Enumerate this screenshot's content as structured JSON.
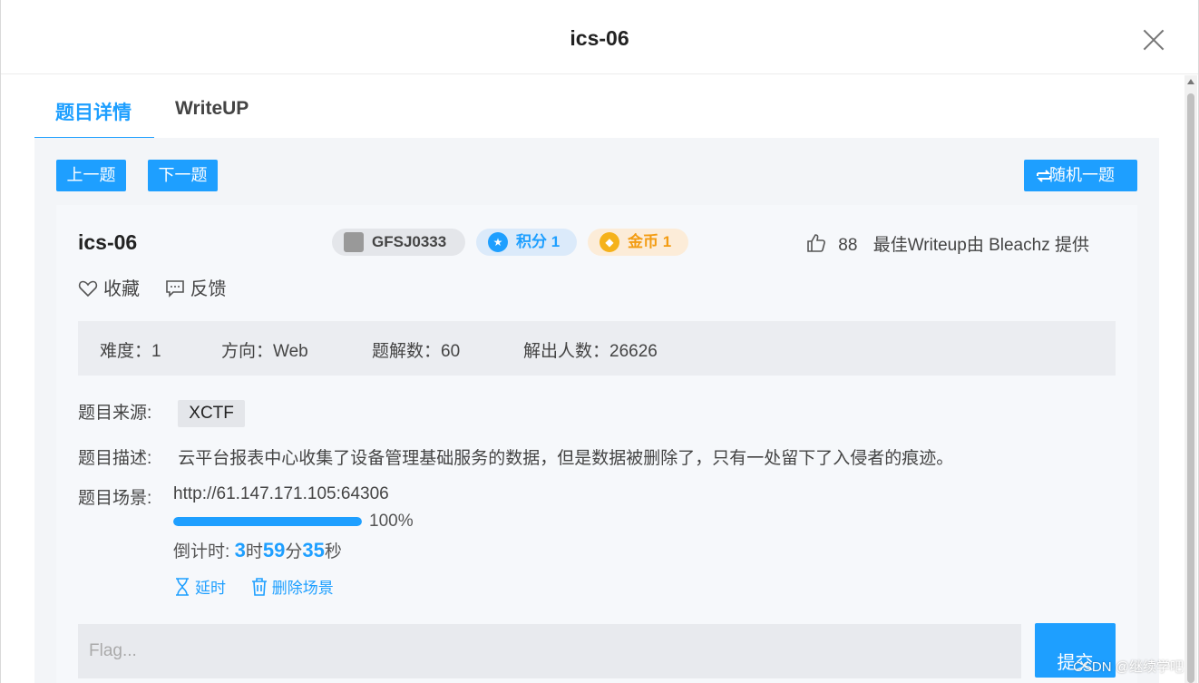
{
  "modal": {
    "title": "ics-06"
  },
  "tabs": [
    {
      "label": "题目详情"
    },
    {
      "label": "WriteUP"
    }
  ],
  "nav": {
    "prev": "上一题",
    "next": "下一题",
    "random": "随机一题"
  },
  "question": {
    "title": "ics-06",
    "badges": {
      "id": "GFSJ0333",
      "score": "积分 1",
      "coin": "金币 1"
    },
    "likes": "88",
    "best_writeup": "最佳Writeup由 Bleachz 提供",
    "actions": {
      "favorite": "收藏",
      "feedback": "反馈"
    },
    "stats": {
      "difficulty": "难度：1",
      "direction": "方向：Web",
      "writeups": "题解数：60",
      "solvers": "解出人数：26626"
    },
    "source_label": "题目来源:",
    "source": "XCTF",
    "desc_label": "题目描述:",
    "description": "云平台报表中心收集了设备管理基础服务的数据，但是数据被删除了，只有一处留下了入侵者的痕迹。",
    "scene_label": "题目场景:",
    "scene_url": "http://61.147.171.105:64306",
    "progress": 100,
    "progress_text": "100%",
    "countdown": {
      "label": "倒计时: ",
      "hours": "3",
      "h_unit": "时",
      "minutes": "59",
      "m_unit": "分",
      "seconds": "35",
      "s_unit": "秒"
    },
    "scene_actions": {
      "extend": "延时",
      "delete": "删除场景"
    },
    "flag_placeholder": "Flag...",
    "submit": "提交"
  },
  "watermark": "CSDN @继续学吧",
  "colors": {
    "accent": "#1e9fff",
    "coin": "#f39c12"
  }
}
